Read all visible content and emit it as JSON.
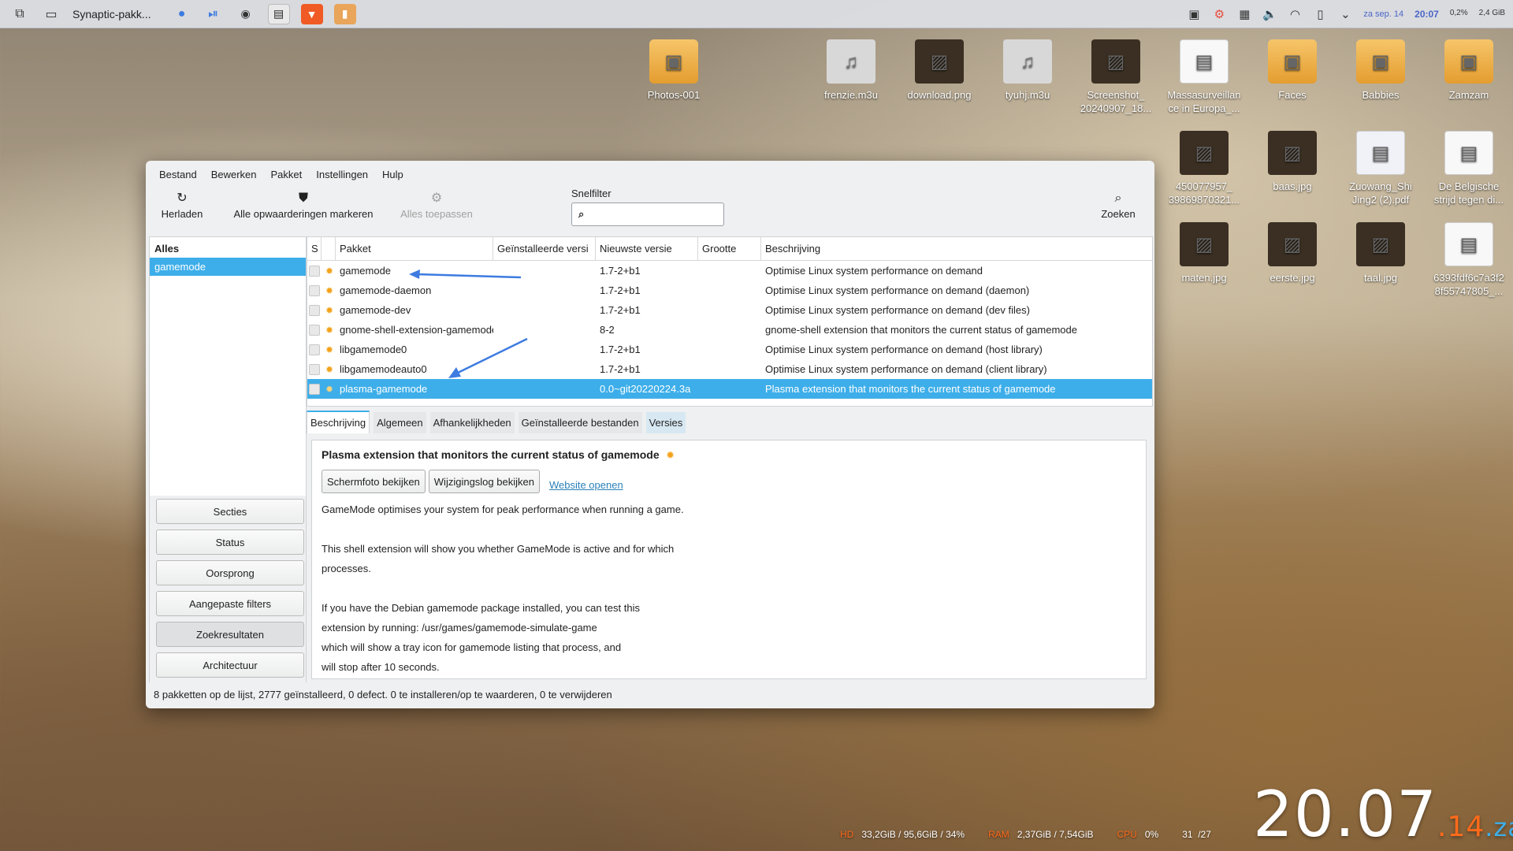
{
  "taskbar": {
    "active_window": "Synaptic-pakk...",
    "tray": {
      "date": "za sep. 14",
      "time": "20:07",
      "cpu_stat": "0,2%",
      "mem_stat": "2,4 GiB"
    }
  },
  "desktop_icons": [
    {
      "label": "Photos-001",
      "type": "folder"
    },
    {
      "label": "frenzie.m3u",
      "type": "audio"
    },
    {
      "label": "download.png",
      "type": "photo"
    },
    {
      "label": "tyuhj.m3u",
      "type": "audio"
    },
    {
      "label": "Screenshot_\n20240907_18...",
      "type": "photo"
    },
    {
      "label": "Massasurveillan\nce in Europa_...",
      "type": "doc"
    },
    {
      "label": "Faces",
      "type": "folder"
    },
    {
      "label": "Babbies",
      "type": "folder"
    },
    {
      "label": "Zamzam",
      "type": "folder"
    },
    {
      "label": "450077957_\n39869870321...",
      "type": "photo"
    },
    {
      "label": "baas.jpg",
      "type": "photo"
    },
    {
      "label": "Zuowang_Shi\nJing2 (2).pdf",
      "type": "pdf"
    },
    {
      "label": "De Belgische\nstrijd tegen di...",
      "type": "doc"
    },
    {
      "label": "maten.jpg",
      "type": "photo"
    },
    {
      "label": "eerste.jpg",
      "type": "photo"
    },
    {
      "label": "taal.jpg",
      "type": "photo"
    },
    {
      "label": "6393fdf6c7a3f2\n8f55747805_...",
      "type": "doc"
    }
  ],
  "window": {
    "menu": [
      "Bestand",
      "Bewerken",
      "Pakket",
      "Instellingen",
      "Hulp"
    ],
    "toolbar": {
      "reload": "Herladen",
      "mark_upgrades": "Alle opwaarderingen markeren",
      "apply": "Alles toepassen",
      "quickfilter_label": "Snelfilter",
      "quickfilter_value": "",
      "search": "Zoeken"
    },
    "sidebar": {
      "header": "Alles",
      "selected": "gamemode",
      "buttons": [
        "Secties",
        "Status",
        "Oorsprong",
        "Aangepaste filters",
        "Zoekresultaten",
        "Architectuur"
      ],
      "active_button": "Zoekresultaten"
    },
    "table": {
      "columns": [
        "S",
        "",
        "Pakket",
        "Geïnstalleerde versi",
        "Nieuwste versie",
        "Grootte",
        "Beschrijving"
      ],
      "rows": [
        {
          "package": "gamemode",
          "installed": "",
          "latest": "1.7-2+b1",
          "size": "",
          "description": "Optimise Linux system performance on demand",
          "selected": false
        },
        {
          "package": "gamemode-daemon",
          "installed": "",
          "latest": "1.7-2+b1",
          "size": "",
          "description": "Optimise Linux system performance on demand (daemon)",
          "selected": false
        },
        {
          "package": "gamemode-dev",
          "installed": "",
          "latest": "1.7-2+b1",
          "size": "",
          "description": "Optimise Linux system performance on demand (dev files)",
          "selected": false
        },
        {
          "package": "gnome-shell-extension-gamemode",
          "installed": "",
          "latest": "8-2",
          "size": "",
          "description": "gnome-shell extension that monitors the current status of gamemode",
          "selected": false
        },
        {
          "package": "libgamemode0",
          "installed": "",
          "latest": "1.7-2+b1",
          "size": "",
          "description": "Optimise Linux system performance on demand (host library)",
          "selected": false
        },
        {
          "package": "libgamemodeauto0",
          "installed": "",
          "latest": "1.7-2+b1",
          "size": "",
          "description": "Optimise Linux system performance on demand (client library)",
          "selected": false
        },
        {
          "package": "plasma-gamemode",
          "installed": "",
          "latest": "0.0~git20220224.3a",
          "size": "",
          "description": "Plasma extension that monitors the current status of gamemode",
          "selected": true
        }
      ]
    },
    "tabs": [
      "Beschrijving",
      "Algemeen",
      "Afhankelijkheden",
      "Geïnstalleerde bestanden",
      "Versies"
    ],
    "details": {
      "title": "Plasma extension that monitors the current status of gamemode",
      "screenshot_button": "Schermfoto bekijken",
      "changelog_button": "Wijzigingslog bekijken",
      "website_link": "Website openen",
      "body": "GameMode optimises your system for peak performance when running a game.\n\nThis shell extension will show you whether GameMode is active and for which\nprocesses.\n\nIf you have the Debian gamemode package installed, you can test this\nextension by running: /usr/games/gamemode-simulate-game\nwhich will show a tray icon for gamemode listing that process, and\nwill stop after 10 seconds."
    },
    "statusbar": "8 pakketten op de lijst, 2777 geïnstalleerd, 0 defect. 0 te installeren/op te waarderen, 0 te verwijderen"
  },
  "bottom_stats": {
    "hd_label": "HD",
    "hd_value": "33,2GiB / 95,6GiB / 34%",
    "ram_label": "RAM",
    "ram_value": "2,37GiB / 7,54GiB",
    "cpu_label": "CPU",
    "cpu_value": "0%",
    "temp_value": "31  /27"
  },
  "clock": {
    "time": "20.07",
    "day": "14",
    "weekday": "za"
  },
  "colors": {
    "accent": "#3daee9",
    "pkg_icon": "#f3a21b",
    "clock_orange": "#ff6a1a"
  }
}
